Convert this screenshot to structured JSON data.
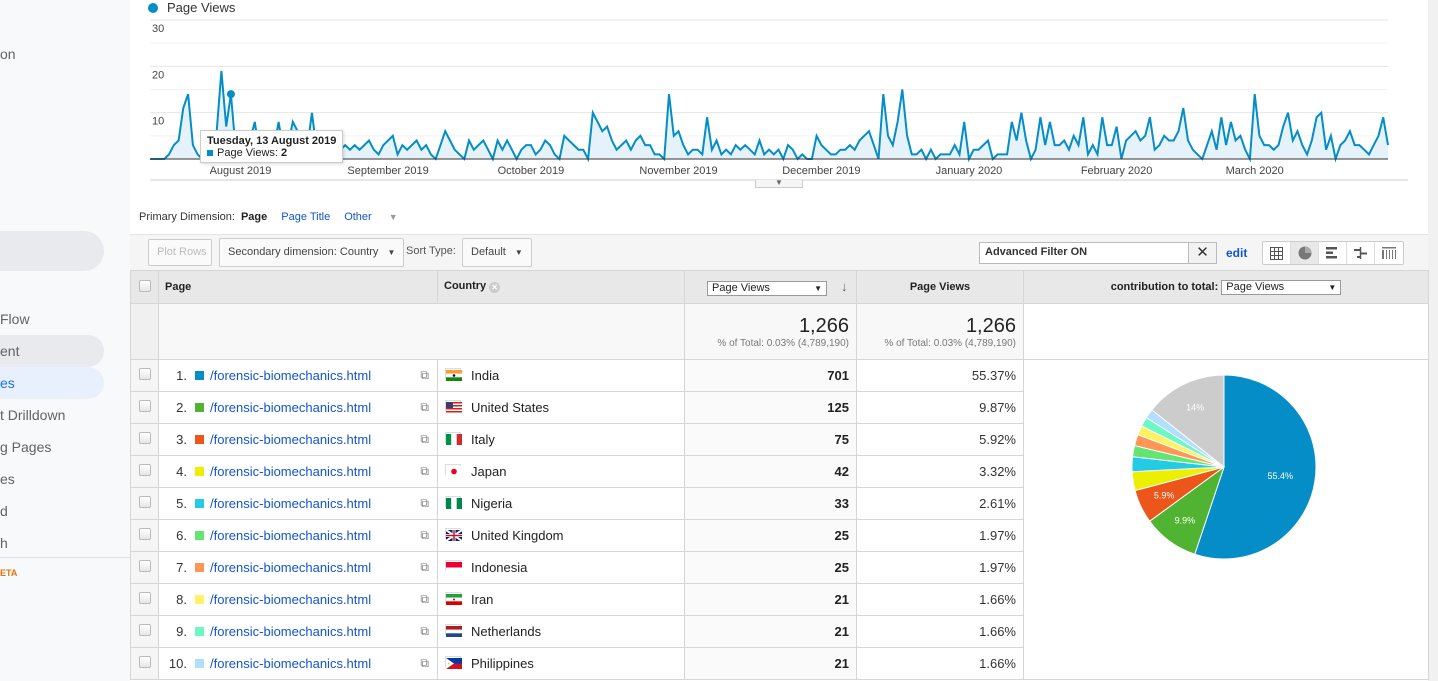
{
  "sidebar": {
    "items": [
      {
        "label": "on",
        "state": "normal"
      },
      {
        "label": "Flow",
        "state": "normal"
      },
      {
        "label": "ent",
        "state": "hover"
      },
      {
        "label": "es",
        "state": "active"
      },
      {
        "label": "t Drilldown",
        "state": "normal"
      },
      {
        "label": "g Pages",
        "state": "normal"
      },
      {
        "label": "es",
        "state": "normal"
      },
      {
        "label": "d",
        "state": "normal"
      },
      {
        "label": "h",
        "state": "normal"
      }
    ],
    "beta_label": "ETA"
  },
  "chart_data": {
    "type": "line",
    "title": "",
    "legend": [
      "Page Views"
    ],
    "legend_position": "top-left",
    "series_color": "#058dc7",
    "ylim": [
      0,
      30
    ],
    "yticks": [
      "10",
      "20",
      "30"
    ],
    "xticks": [
      "August 2019",
      "September 2019",
      "October 2019",
      "November 2019",
      "December 2019",
      "January 2020",
      "February 2020",
      "March 2020"
    ],
    "x_start": "2019-07-27",
    "series": [
      {
        "name": "Page Views",
        "values": [
          0,
          0,
          0,
          0,
          1,
          3,
          4,
          11,
          14,
          3,
          1,
          0,
          2,
          0,
          6,
          19,
          7,
          14,
          2,
          2,
          0,
          4,
          8,
          1,
          2,
          6,
          2,
          8,
          2,
          3,
          8,
          6,
          2,
          2,
          10,
          2,
          4,
          2,
          2,
          3,
          2,
          3,
          2,
          3,
          2,
          3,
          4,
          2,
          1,
          3,
          4,
          5,
          1,
          3,
          2,
          3,
          4,
          2,
          3,
          1,
          0,
          3,
          6,
          4,
          2,
          1,
          0,
          4,
          2,
          3,
          4,
          2,
          0,
          4,
          2,
          4,
          2,
          0,
          2,
          3,
          3,
          1,
          2,
          4,
          3,
          1,
          0,
          5,
          4,
          3,
          2,
          2,
          0,
          10,
          8,
          6,
          7,
          4,
          2,
          3,
          4,
          2,
          4,
          5,
          3,
          3,
          1,
          1,
          0,
          14,
          5,
          6,
          3,
          1,
          2,
          2,
          1,
          9,
          2,
          4,
          1,
          2,
          1,
          3,
          2,
          3,
          2,
          1,
          4,
          1,
          2,
          1,
          2,
          0,
          3,
          2,
          0,
          1,
          0,
          0,
          5,
          3,
          2,
          1,
          1,
          2,
          2,
          3,
          2,
          4,
          5,
          6,
          3,
          0,
          14,
          5,
          3,
          8,
          15,
          5,
          1,
          1,
          2,
          0,
          2,
          0,
          1,
          1,
          1,
          3,
          1,
          8,
          0,
          2,
          2,
          3,
          4,
          0,
          1,
          1,
          1,
          8,
          4,
          10,
          4,
          0,
          2,
          9,
          3,
          8,
          3,
          3,
          4,
          2,
          5,
          3,
          9,
          1,
          3,
          1,
          9,
          3,
          3,
          7,
          0,
          4,
          5,
          6,
          4,
          5,
          9,
          2,
          3,
          5,
          4,
          4,
          6,
          11,
          4,
          2,
          1,
          0,
          3,
          6,
          2,
          9,
          3,
          8,
          4,
          5,
          2,
          0,
          14,
          5,
          3,
          3,
          2,
          3,
          7,
          10,
          4,
          6,
          3,
          1,
          4,
          9,
          10,
          2,
          5,
          0,
          3,
          4,
          6,
          3,
          3,
          2,
          1,
          3,
          5,
          9,
          3
        ],
        "color": "#058dc7"
      }
    ],
    "tooltip": {
      "date": "Tuesday, 13 August 2019",
      "label": "Page Views:",
      "value": "2"
    }
  },
  "primary_dimension": {
    "label": "Primary Dimension:",
    "current": "Page",
    "options": [
      "Page Title",
      "Other"
    ]
  },
  "toolbar": {
    "plot_rows": "Plot Rows",
    "secondary_dimension": "Secondary dimension: Country",
    "sort_type_label": "Sort Type:",
    "sort_type_value": "Default",
    "filter_text": "Advanced Filter ON",
    "edit_label": "edit",
    "views": [
      "table-view",
      "pie-view",
      "performance-view",
      "comparison-view",
      "pivot-view"
    ],
    "active_view": "pie-view"
  },
  "table": {
    "headers": {
      "page": "Page",
      "country": "Country",
      "metric_select": "Page Views",
      "metric": "Page Views",
      "contribution_label": "contribution to total:",
      "contribution_select": "Page Views"
    },
    "totals": {
      "value": "1,266",
      "pct_text": "% of Total: 0.03% (4,789,190)",
      "value2": "1,266",
      "pct_text2": "% of Total: 0.03% (4,789,190)"
    },
    "rows": [
      {
        "num": "1.",
        "page": "/forensic-biomechanics.html",
        "country": "India",
        "flag": "india",
        "views": "701",
        "pct": "55.37%",
        "color": "#058dc7"
      },
      {
        "num": "2.",
        "page": "/forensic-biomechanics.html",
        "country": "United States",
        "flag": "us",
        "views": "125",
        "pct": "9.87%",
        "color": "#50b432"
      },
      {
        "num": "3.",
        "page": "/forensic-biomechanics.html",
        "country": "Italy",
        "flag": "italy",
        "views": "75",
        "pct": "5.92%",
        "color": "#ed561b"
      },
      {
        "num": "4.",
        "page": "/forensic-biomechanics.html",
        "country": "Japan",
        "flag": "japan",
        "views": "42",
        "pct": "3.32%",
        "color": "#edef00"
      },
      {
        "num": "5.",
        "page": "/forensic-biomechanics.html",
        "country": "Nigeria",
        "flag": "nigeria",
        "views": "33",
        "pct": "2.61%",
        "color": "#24cbe5"
      },
      {
        "num": "6.",
        "page": "/forensic-biomechanics.html",
        "country": "United Kingdom",
        "flag": "uk",
        "views": "25",
        "pct": "1.97%",
        "color": "#64e572"
      },
      {
        "num": "7.",
        "page": "/forensic-biomechanics.html",
        "country": "Indonesia",
        "flag": "indonesia",
        "views": "25",
        "pct": "1.97%",
        "color": "#ff9655"
      },
      {
        "num": "8.",
        "page": "/forensic-biomechanics.html",
        "country": "Iran",
        "flag": "iran",
        "views": "21",
        "pct": "1.66%",
        "color": "#fff263"
      },
      {
        "num": "9.",
        "page": "/forensic-biomechanics.html",
        "country": "Netherlands",
        "flag": "netherlands",
        "views": "21",
        "pct": "1.66%",
        "color": "#6af9c4"
      },
      {
        "num": "10.",
        "page": "/forensic-biomechanics.html",
        "country": "Philippines",
        "flag": "philippines",
        "views": "21",
        "pct": "1.66%",
        "color": "#b2deff"
      }
    ],
    "pie": {
      "slices": [
        {
          "value": 55.37,
          "color": "#058dc7",
          "label": "55.4%"
        },
        {
          "value": 9.87,
          "color": "#50b432",
          "label": "9.9%"
        },
        {
          "value": 5.92,
          "color": "#ed561b",
          "label": "5.9%"
        },
        {
          "value": 3.32,
          "color": "#edef00",
          "label": ""
        },
        {
          "value": 2.61,
          "color": "#24cbe5",
          "label": ""
        },
        {
          "value": 1.97,
          "color": "#64e572",
          "label": ""
        },
        {
          "value": 1.97,
          "color": "#ff9655",
          "label": ""
        },
        {
          "value": 1.66,
          "color": "#fff263",
          "label": ""
        },
        {
          "value": 1.66,
          "color": "#6af9c4",
          "label": ""
        },
        {
          "value": 1.66,
          "color": "#b2deff",
          "label": ""
        },
        {
          "value": 14.39,
          "color": "#cccccc",
          "label": "14%"
        }
      ]
    }
  }
}
